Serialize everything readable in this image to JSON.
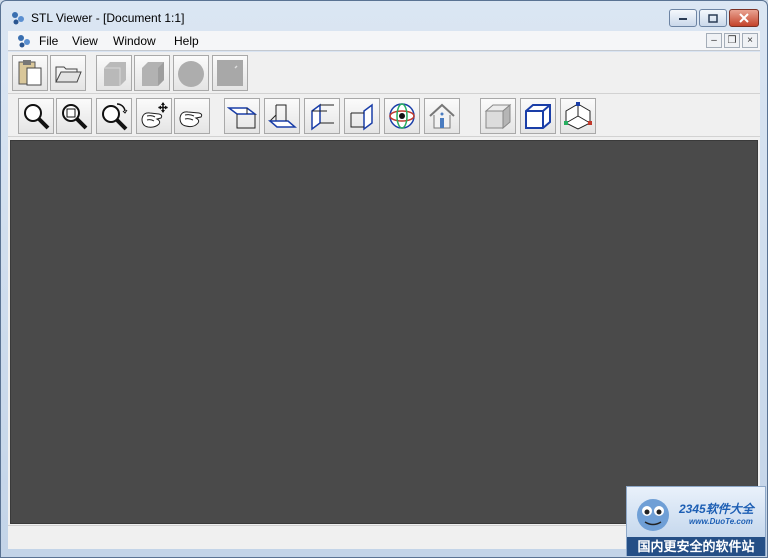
{
  "window": {
    "title": "STL Viewer - [Document 1:1]"
  },
  "menu": {
    "items": [
      "File",
      "View",
      "Window",
      "Help"
    ]
  },
  "mdi_controls": {
    "minimize": "–",
    "restore": "❐",
    "close": "×"
  },
  "toolbar1": {
    "tools": [
      "paste-icon",
      "open-folder-icon",
      "solid-box-icon",
      "shaded-box-icon",
      "sphere-icon",
      "square-icon"
    ]
  },
  "toolbar2": {
    "tools": [
      "zoom-icon",
      "zoom-window-icon",
      "zoom-rotate-icon",
      "pan-hand-icon",
      "rotate-hand-icon",
      "top-view-icon",
      "front-view-icon",
      "left-view-icon",
      "right-view-icon",
      "orbit-icon",
      "home-icon",
      "solid-cube-icon",
      "wireframe-cube-icon",
      "axis-cube-icon"
    ]
  },
  "watermark": {
    "brand": "2345软件大全",
    "url": "www.DuoTe.com",
    "slogan": "国内更安全的软件站"
  },
  "colors": {
    "viewport": "#4a4a4a",
    "accent": "#1d5fb4"
  }
}
